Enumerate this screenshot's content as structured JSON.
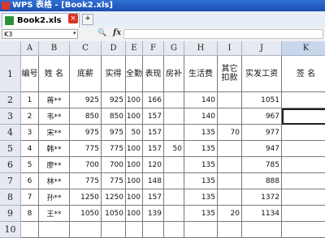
{
  "window": {
    "title": "WPS 表格 - [Book2.xls]"
  },
  "tabs": [
    {
      "label": "Book2.xls"
    }
  ],
  "tab_close_glyph": "×",
  "tab_new_glyph": "+",
  "formula_bar": {
    "name_box": "K3",
    "name_box_arrow": "▾",
    "zoom_glyph": "🔍",
    "fx_label": "fx",
    "content": ""
  },
  "columns": [
    "A",
    "B",
    "C",
    "D",
    "E",
    "F",
    "G",
    "H",
    "I",
    "J",
    "K"
  ],
  "selected_column": "K",
  "rows": [
    "1",
    "2",
    "3",
    "4",
    "5",
    "6",
    "7",
    "8",
    "9",
    "10"
  ],
  "header_row": [
    "编号",
    "姓 名",
    "底薪",
    "实得",
    "全勤",
    "表现",
    "房补",
    "生活费",
    "其它扣款",
    "实发工资",
    "签 名"
  ],
  "data_rows": [
    [
      "1",
      "蒋**",
      "925",
      "925",
      "100",
      "166",
      "",
      "140",
      "",
      "1051",
      ""
    ],
    [
      "2",
      "韦**",
      "850",
      "850",
      "100",
      "157",
      "",
      "140",
      "",
      "967",
      ""
    ],
    [
      "3",
      "宋**",
      "975",
      "975",
      "50",
      "157",
      "",
      "135",
      "70",
      "977",
      ""
    ],
    [
      "4",
      "韩**",
      "775",
      "775",
      "100",
      "157",
      "50",
      "135",
      "",
      "947",
      ""
    ],
    [
      "5",
      "廖**",
      "700",
      "700",
      "100",
      "120",
      "",
      "135",
      "",
      "785",
      ""
    ],
    [
      "6",
      "林**",
      "775",
      "775",
      "100",
      "148",
      "",
      "135",
      "",
      "888",
      ""
    ],
    [
      "7",
      "孙**",
      "1250",
      "1250",
      "100",
      "157",
      "",
      "135",
      "",
      "1372",
      ""
    ],
    [
      "8",
      "王**",
      "1050",
      "1050",
      "100",
      "139",
      "",
      "135",
      "20",
      "1134",
      ""
    ]
  ],
  "selected_cell": "K3",
  "colors": {
    "titlebar": "#1b4fb1",
    "header_bg": "#e5e9f0",
    "selected_header": "#c9d7ec"
  }
}
